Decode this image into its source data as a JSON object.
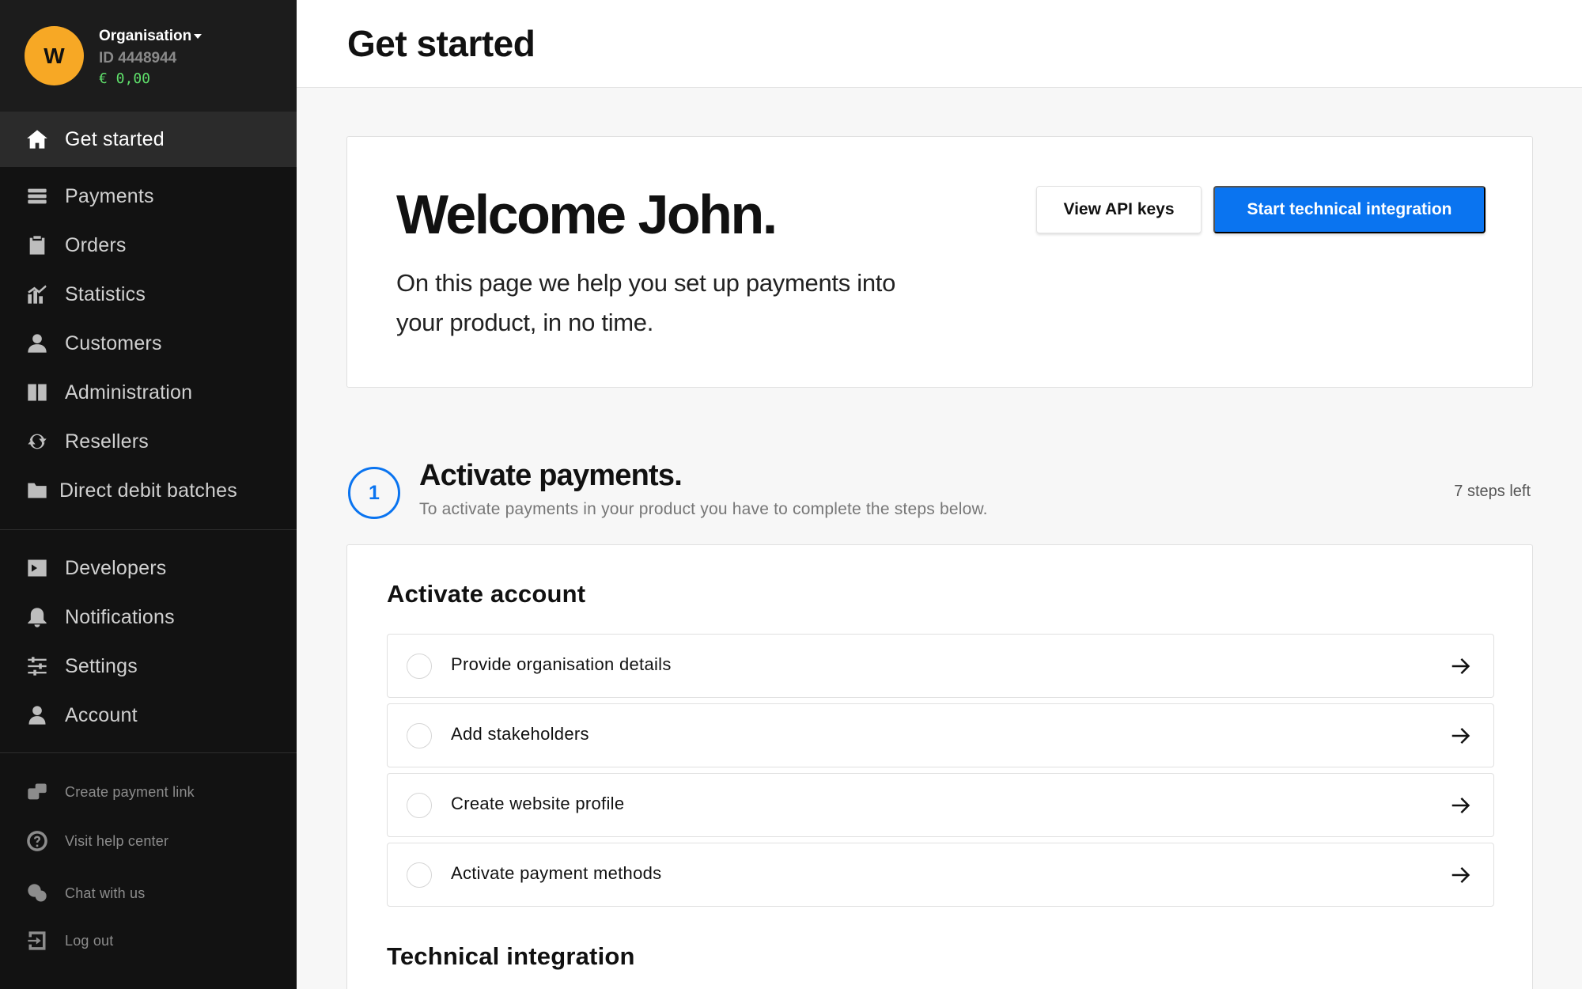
{
  "org": {
    "avatar_letter": "W",
    "name": "Organisation",
    "id": "ID 4448944",
    "balance": "€ 0,00"
  },
  "nav": {
    "main": [
      {
        "label": "Get started",
        "icon": "home-icon"
      },
      {
        "label": "Payments",
        "icon": "payments-icon"
      },
      {
        "label": "Orders",
        "icon": "clipboard-icon"
      },
      {
        "label": "Statistics",
        "icon": "chart-icon"
      },
      {
        "label": "Customers",
        "icon": "users-icon"
      },
      {
        "label": "Administration",
        "icon": "book-icon"
      },
      {
        "label": "Resellers",
        "icon": "sync-icon"
      },
      {
        "label": "Direct debit batches",
        "icon": "folder-icon"
      }
    ],
    "secondary": [
      {
        "label": "Developers",
        "icon": "terminal-icon"
      },
      {
        "label": "Notifications",
        "icon": "bell-icon"
      },
      {
        "label": "Settings",
        "icon": "sliders-icon"
      },
      {
        "label": "Account",
        "icon": "user-icon"
      }
    ],
    "footer": [
      {
        "label": "Create payment link",
        "icon": "link-icon"
      },
      {
        "label": "Visit help center",
        "icon": "help-icon"
      },
      {
        "label": "Chat with us",
        "icon": "chat-icon"
      },
      {
        "label": "Log out",
        "icon": "logout-icon"
      }
    ]
  },
  "header": {
    "title": "Get started"
  },
  "welcome": {
    "title": "Welcome John.",
    "text": "On this page we help you set up payments into your product, in no time.",
    "view_api_keys": "View API keys",
    "start_integration": "Start technical integration"
  },
  "step": {
    "number": "1",
    "title": "Activate payments.",
    "subtitle": "To activate payments in your product you have to complete the steps below.",
    "steps_left": "7 steps left"
  },
  "activate_account": {
    "title": "Activate account",
    "tasks": [
      "Provide organisation details",
      "Add stakeholders",
      "Create website profile",
      "Activate payment methods"
    ]
  },
  "technical_integration": {
    "title": "Technical integration"
  },
  "colors": {
    "accent": "#0a74f0",
    "avatar": "#f7a825",
    "balance": "#5fe06b",
    "sidebar": "#121212"
  }
}
